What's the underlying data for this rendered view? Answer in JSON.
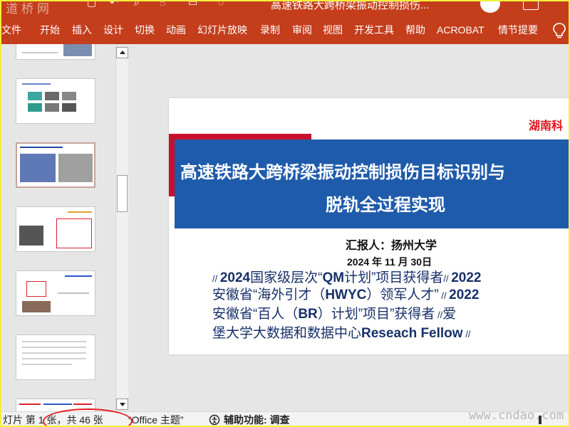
{
  "app": {
    "watermark_text": "道桥网",
    "document_title": "高速铁路大跨桥梁振动控制损伤...",
    "accent_color": "#c43e1c"
  },
  "ribbon": {
    "tabs": [
      "文件",
      "开始",
      "插入",
      "设计",
      "切换",
      "动画",
      "幻灯片放映",
      "录制",
      "审阅",
      "视图",
      "开发工具",
      "帮助",
      "ACROBAT",
      "情节提要"
    ],
    "tell_me_icon": "lightbulb-icon"
  },
  "thumbnails": {
    "count_visible": 7,
    "selected_index": 2
  },
  "slide": {
    "university": "湖南科",
    "title_line1": "高速铁路大跨桥梁振动控制损伤目标识别与",
    "title_line2": "脱轨全过程实现",
    "presenter": "汇报人：扬州大学",
    "date": "2024 年 11 月 30日",
    "credentials": [
      {
        "pre": "// ",
        "a": "2024",
        "b": "国家级层次“",
        "c": "QM",
        "d": "计划”项目获得者",
        "post": "// ",
        "e": "2022"
      },
      {
        "pre": "",
        "a": "",
        "b": "安徽省“海外引才（",
        "c": "HWYC",
        "d": "）领军人才”",
        "post": " // ",
        "e": "2022"
      },
      {
        "pre": "",
        "a": "",
        "b": "安徽省“百人（",
        "c": "BR",
        "d": "）计划”项目”获得者",
        "post": " //",
        "e": "爱"
      },
      {
        "pre": "",
        "a": "",
        "b": "堡大学大数据和数据中心",
        "c": "Reseach Fellow",
        "d": "",
        "post": " //",
        "e": ""
      }
    ]
  },
  "statusbar": {
    "slide_info": "灯片 第 1 张，共 46 张",
    "theme": "“Office 主题”",
    "accessibility": "辅助功能: 调查",
    "site_watermark": "www.cndao.com"
  }
}
